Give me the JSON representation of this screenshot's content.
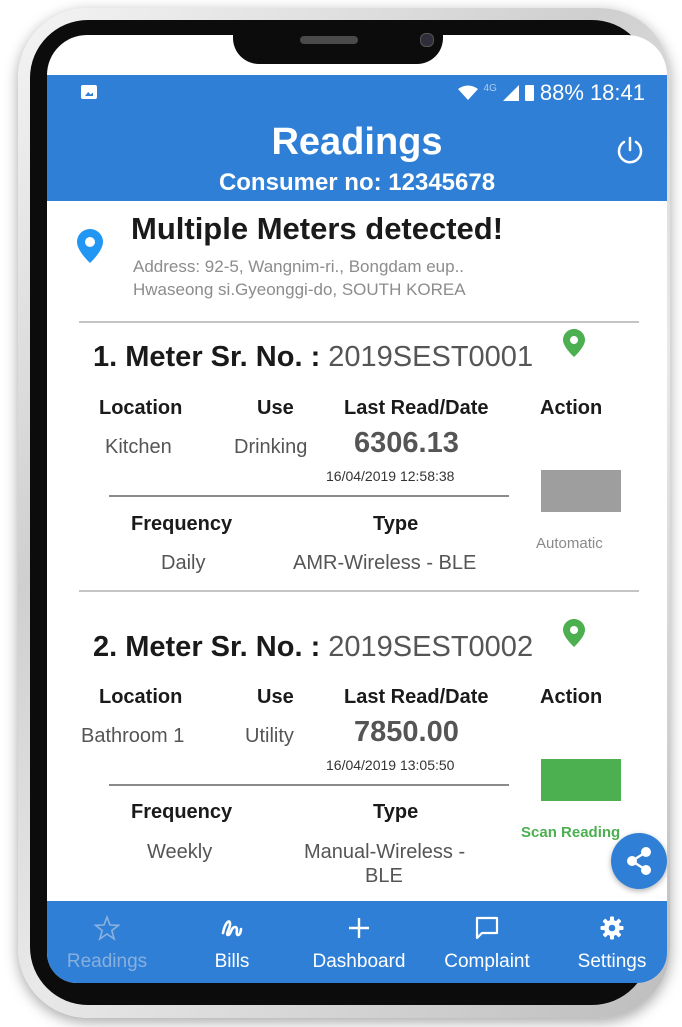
{
  "status_bar": {
    "network_label": "4G",
    "battery": "88%",
    "time": "18:41",
    "icons": [
      "photo-icon",
      "wifi-icon",
      "signal-icon",
      "battery-icon"
    ]
  },
  "header": {
    "title": "Readings",
    "consumer_label": "Consumer no: 12345678",
    "power_icon": "power-icon"
  },
  "alert": {
    "title": "Multiple Meters detected!",
    "address_line1": "Address: 92-5, Wangnim-ri., Bongdam eup..",
    "address_line2": "Hwaseong si.Gyeonggi-do, SOUTH KOREA"
  },
  "columns": {
    "location": "Location",
    "use": "Use",
    "last_read": "Last Read/Date",
    "action": "Action",
    "frequency": "Frequency",
    "type": "Type"
  },
  "meters": [
    {
      "title_prefix": "1. Meter Sr. No. :",
      "serial": "2019SEST0001",
      "location": "Kitchen",
      "use": "Drinking",
      "reading": "6306.13",
      "date": "16/04/2019 12:58:38",
      "frequency": "Daily",
      "type": "AMR-Wireless - BLE",
      "type_line2": "",
      "action_label": "Automatic",
      "action_color": "#9e9e9e"
    },
    {
      "title_prefix": "2. Meter Sr. No. :",
      "serial": "2019SEST0002",
      "location": "Bathroom 1",
      "use": "Utility",
      "reading": "7850.00",
      "date": "16/04/2019 13:05:50",
      "frequency": "Weekly",
      "type": "Manual-Wireless -",
      "type_line2": "BLE",
      "action_label": "Scan Reading",
      "action_color": "#4caf50"
    }
  ],
  "share_icon": "share-icon",
  "bottom_nav": [
    {
      "label": "Readings",
      "icon": "star-icon",
      "active": true
    },
    {
      "label": "Bills",
      "icon": "bills-icon",
      "active": false
    },
    {
      "label": "Dashboard",
      "icon": "plus-icon",
      "active": false
    },
    {
      "label": "Complaint",
      "icon": "chat-icon",
      "active": false
    },
    {
      "label": "Settings",
      "icon": "gear-icon",
      "active": false
    }
  ],
  "colors": {
    "primary": "#2f7fd6",
    "location_pin": "#2196f3",
    "meter_pin": "#4caf50",
    "scan_green": "#4caf50",
    "automatic_grey": "#9e9e9e"
  }
}
